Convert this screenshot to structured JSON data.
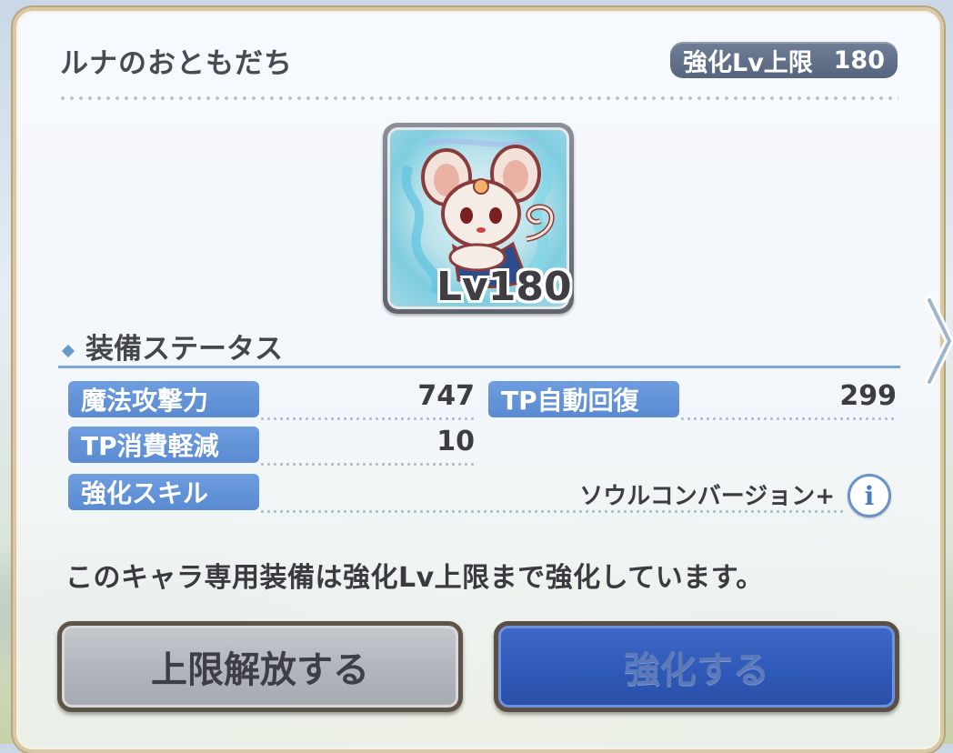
{
  "header": {
    "title": "ルナのおともだち",
    "limit_label": "強化Lv上限",
    "limit_value": "180"
  },
  "equipment": {
    "icon": "mouse-creature-icon",
    "level_text": "Lv180"
  },
  "status": {
    "section_title": "装備ステータス",
    "rows": [
      {
        "label": "魔法攻撃力",
        "value": "747"
      },
      {
        "label": "TP自動回復",
        "value": "299"
      },
      {
        "label": "TP消費軽減",
        "value": "10"
      },
      {
        "label": "強化スキル",
        "value": "ソウルコンバージョン+"
      }
    ],
    "info_icon_glyph": "i"
  },
  "message": "このキャラ専用装備は強化Lv上限まで強化しています。",
  "buttons": {
    "limit_break": "上限解放する",
    "enhance": "強化する"
  },
  "colors": {
    "label_blue": "#5a8ad0",
    "enhance_button_blue": "#2f59b8",
    "limit_badge": "#5f6e86"
  }
}
